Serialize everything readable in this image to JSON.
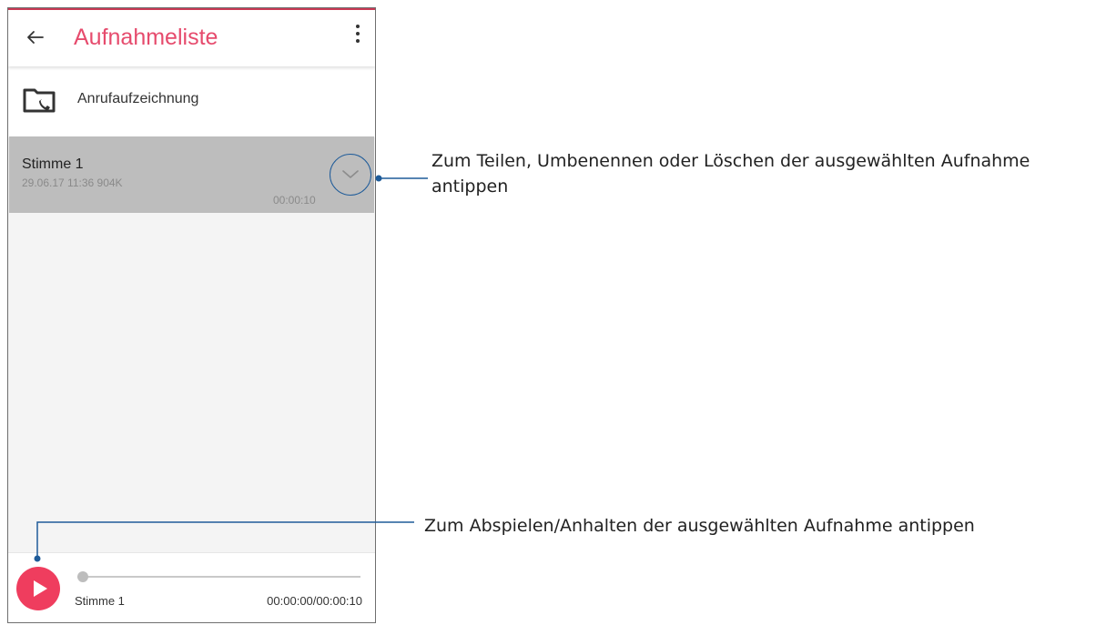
{
  "app": {
    "title": "Aufnahmeliste"
  },
  "folder": {
    "label": "Anrufaufzeichnung"
  },
  "recording": {
    "name": "Stimme 1",
    "meta": "29.06.17 11:36   904K",
    "duration": "00:00:10"
  },
  "player": {
    "name": "Stimme 1",
    "time": "00:00:00/00:00:10",
    "progress_fraction": 0
  },
  "callouts": {
    "expand": "Zum Teilen, Umbenennen oder Löschen der ausgewählten Aufnahme antippen",
    "play": "Zum Abspielen/Anhalten der ausgewählten Aufnahme antippen"
  },
  "colors": {
    "accent": "#e64b6d",
    "play_button": "#ef3d5e",
    "callout_line": "#1e5b99",
    "selected_row": "#bdbdbd"
  },
  "icons": {
    "back": "back-arrow-icon",
    "more": "more-vertical-icon",
    "folder": "call-recording-folder-icon",
    "expand": "chevron-down-icon",
    "play": "play-icon"
  }
}
